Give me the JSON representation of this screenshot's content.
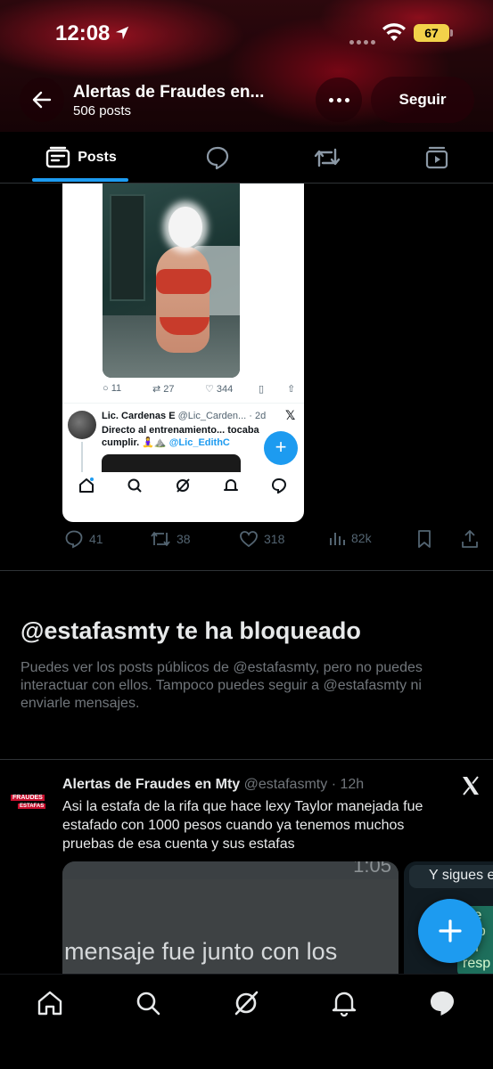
{
  "status": {
    "time": "12:08",
    "battery": "67"
  },
  "header": {
    "title": "Alertas de Fraudes en...",
    "post_count": "506 posts",
    "follow_label": "Seguir"
  },
  "tabs": {
    "posts_label": "Posts"
  },
  "embedded": {
    "replies": "11",
    "reposts": "27",
    "likes": "344",
    "quoted_name": "Lic. Cardenas E",
    "quoted_handle": "@Lic_Carden...",
    "quoted_time": "· 2d",
    "quoted_text": "Directo al entrenamiento... tocaba cumplir. 🧘‍♀️⛰️",
    "quoted_mention": "@Lic_EdithC"
  },
  "post_actions": {
    "replies": "41",
    "reposts": "38",
    "likes": "318",
    "views": "82k"
  },
  "blocked": {
    "title": "@estafasmty te ha bloqueado",
    "text": "Puedes ver los posts públicos de @estafasmty, pero no puedes interactuar con ellos. Tampoco puedes seguir a @estafasmty ni enviarle mensajes."
  },
  "post": {
    "avatar_line1": "FRAUDES",
    "avatar_line2": "ESTAFAS",
    "name": "Alertas de Fraudes en Mty",
    "handle": "@estafasmty",
    "time": "· 12h",
    "text": "Asi la estafa de la rifa que hace lexy Taylor manejada fue estafado  con 1000 pesos cuando ya tenemos muchos pruebas de esa cuenta y sus estafas",
    "media1_time": "1:05",
    "media1_text": "mensaje fue junto con los",
    "media2_text": "Y sigues e",
    "media2_green": "i te\nesp\nan\nresp"
  },
  "colors": {
    "accent": "#1d9bf0",
    "banner": "#c8102e"
  }
}
